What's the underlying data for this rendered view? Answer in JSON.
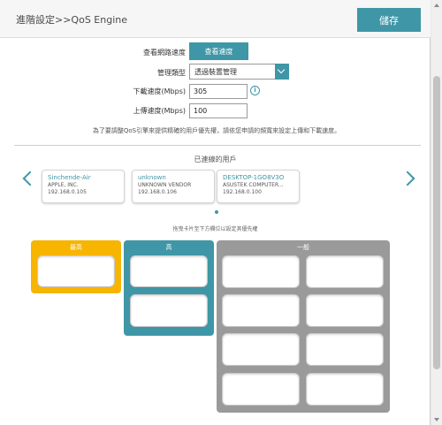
{
  "header": {
    "title": "進階設定>>QoS Engine",
    "save_label": "儲存"
  },
  "form": {
    "check_speed_label": "查看網路速度",
    "check_speed_button": "查看速度",
    "management_type_label": "管理類型",
    "management_type_value": "透過裝置管理",
    "download_label": "下載速度(Mbps)",
    "download_value": "305",
    "upload_label": "上傳速度(Mbps)",
    "upload_value": "100",
    "note": "為了要調整QoS引擎來提供精確的用戶優先權，請依您申請的頻寬來設定上傳和下載速度。"
  },
  "connected": {
    "title": "已連線的用戶",
    "devices": [
      {
        "name": "Sinchende-Air",
        "vendor": "APPLE, INC.",
        "ip": "192.168.0.105"
      },
      {
        "name": "unknown",
        "vendor": "UNKNOWN VENDOR",
        "ip": "192.168.0.106"
      },
      {
        "name": "DESKTOP-1GO8V3O",
        "vendor": "ASUSTEK COMPUTER...",
        "ip": "192.168.0.100"
      }
    ],
    "drag_note": "拖曳卡片至下方欄位以設定其優先權"
  },
  "priority": {
    "highest": "最高",
    "high": "高",
    "normal": "一般"
  },
  "colors": {
    "accent": "#3f96a6",
    "highest_zone": "#f7b500",
    "normal_zone": "#9a9a9a"
  }
}
